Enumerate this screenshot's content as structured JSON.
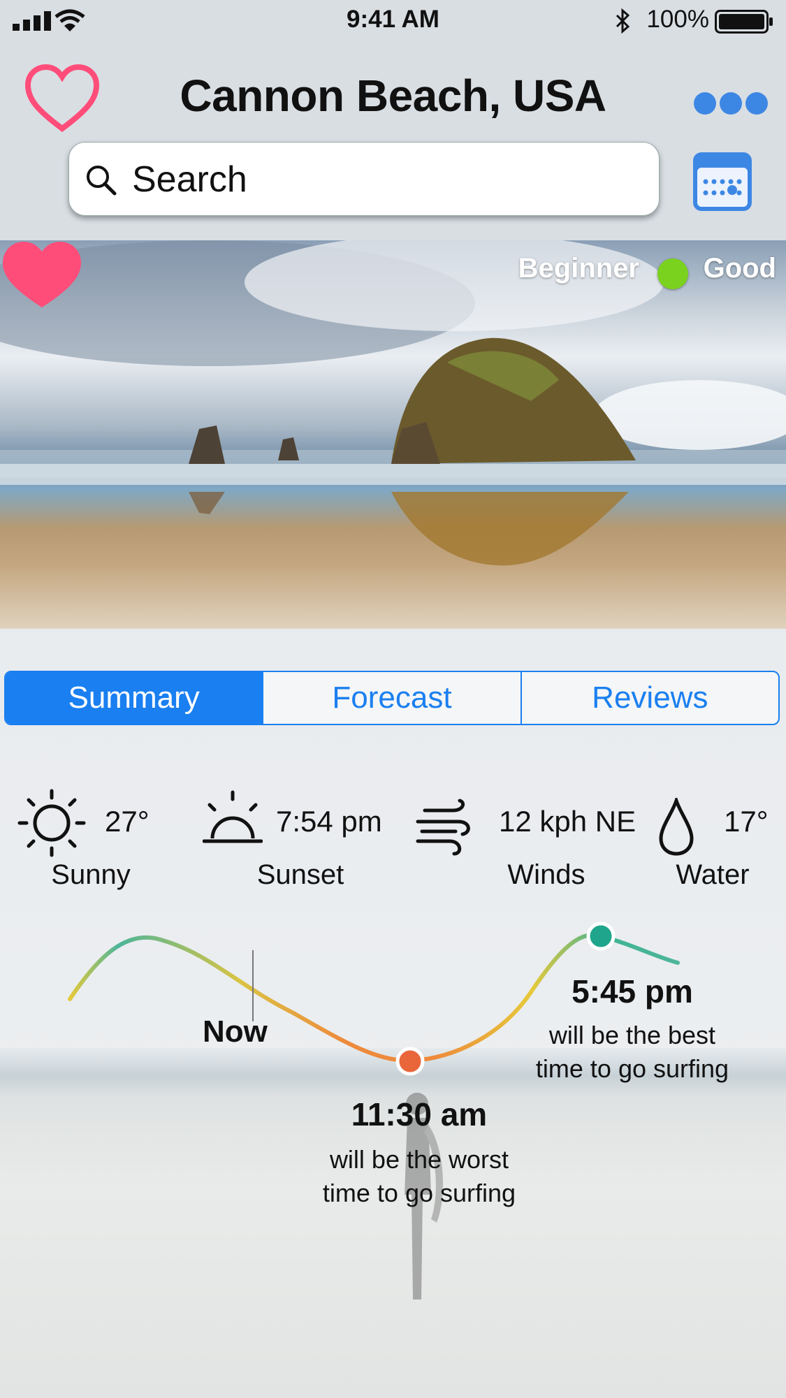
{
  "status_bar": {
    "time": "9:41 AM",
    "battery": "100%"
  },
  "header": {
    "title": "Cannon Beach, USA",
    "search_placeholder": "Search"
  },
  "hero": {
    "skill_level": "Beginner",
    "condition": "Good",
    "condition_color": "#7bd21e"
  },
  "tabs": [
    {
      "label": "Summary",
      "active": true
    },
    {
      "label": "Forecast",
      "active": false
    },
    {
      "label": "Reviews",
      "active": false
    }
  ],
  "stats": {
    "weather": {
      "value": "27°",
      "label": "Sunny",
      "icon": "sun-icon"
    },
    "sunset": {
      "value": "7:54 pm",
      "label": "Sunset",
      "icon": "sunset-icon"
    },
    "winds": {
      "value": "12 kph NE",
      "label": "Winds",
      "icon": "wind-icon"
    },
    "water": {
      "value": "17°",
      "label": "Water",
      "icon": "droplet-icon"
    }
  },
  "surf_chart": {
    "now_label": "Now",
    "best_time": "5:45 pm",
    "best_desc_1": "will be the best",
    "best_desc_2": "time to go surfing",
    "worst_time": "11:30 am",
    "worst_desc_1": "will be the worst",
    "worst_desc_2": "time to go surfing"
  },
  "colors": {
    "accent": "#1a7ff0",
    "favorite": "#ff4d7a",
    "best_marker": "#1fa58c",
    "worst_marker": "#e8663a"
  }
}
